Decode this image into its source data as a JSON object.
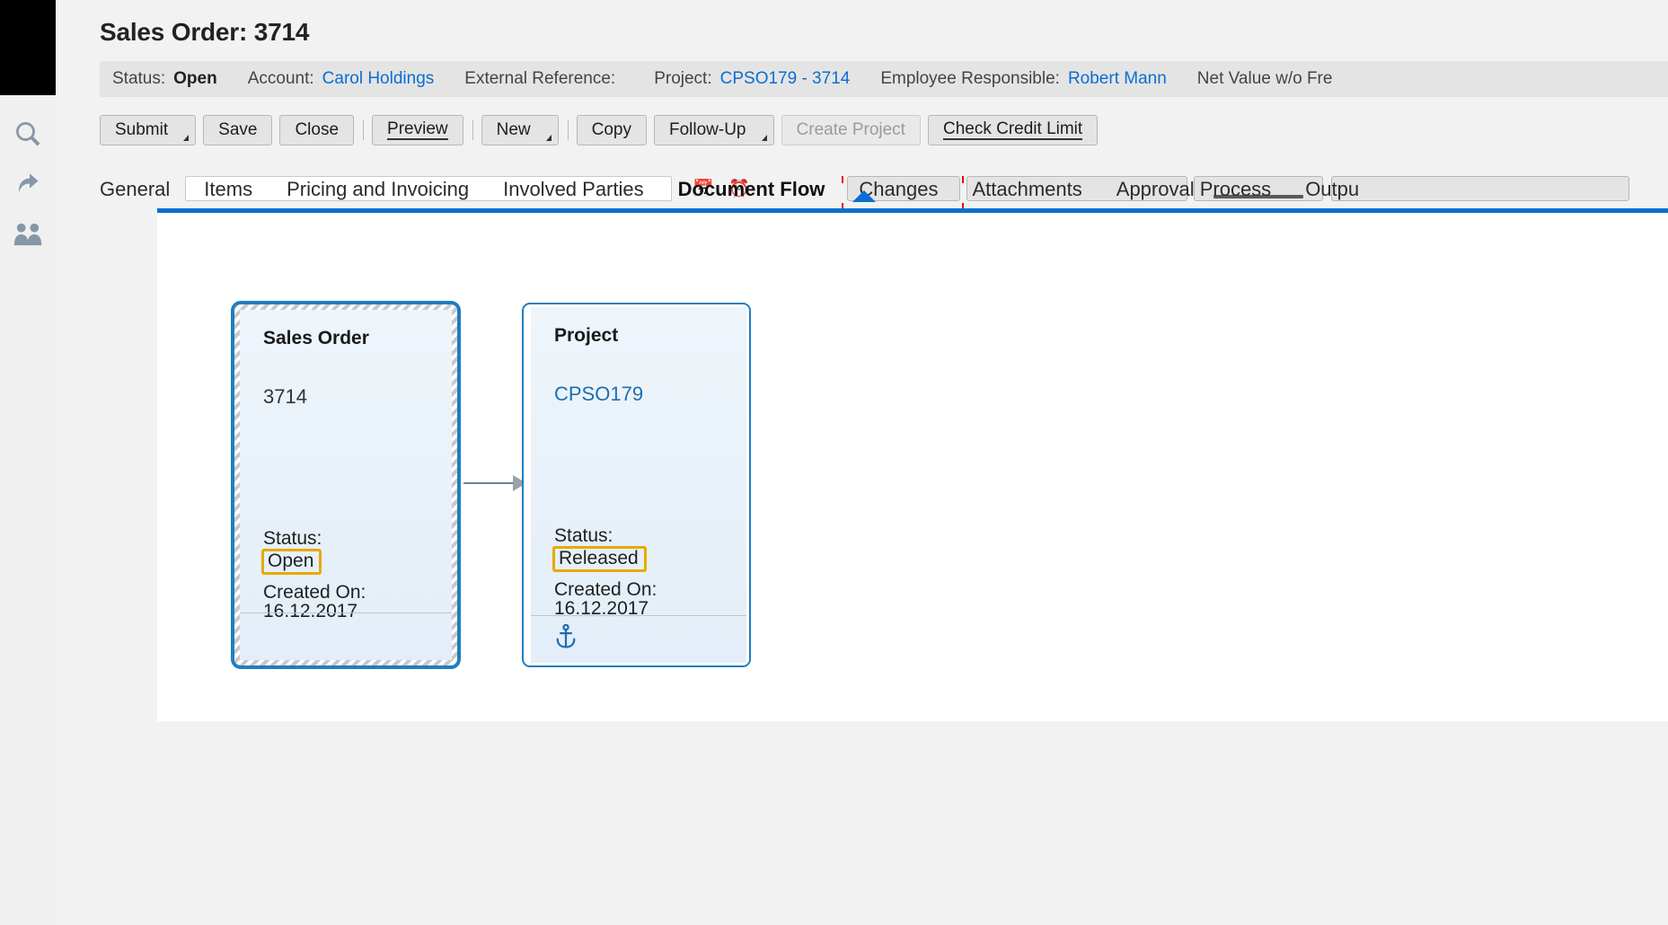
{
  "window": {
    "page_title": "Sales Order: 3714"
  },
  "rail": {
    "items": [
      {
        "name": "search-icon",
        "label": "Search"
      },
      {
        "name": "back-arrow-icon",
        "label": "Back"
      },
      {
        "name": "contacts-icon",
        "label": "Contacts"
      }
    ]
  },
  "statusbar": {
    "items": [
      {
        "label": "Status:",
        "value": "Open",
        "kind": "strong"
      },
      {
        "label": "Account:",
        "value": "Carol Holdings",
        "kind": "link"
      },
      {
        "label": "External Reference:",
        "value": "",
        "kind": "plain"
      },
      {
        "label": "Project:",
        "value": "CPSO179 - 3714",
        "kind": "link"
      },
      {
        "label": "Employee Responsible:",
        "value": "Robert Mann",
        "kind": "link"
      },
      {
        "label": "Net Value w/o Fre",
        "value": "",
        "kind": "plain"
      }
    ]
  },
  "toolbar": {
    "buttons": [
      {
        "label": "Submit",
        "caret": true,
        "disabled": false,
        "underline": false,
        "sep_after": false
      },
      {
        "label": "Save",
        "caret": false,
        "disabled": false,
        "underline": false,
        "sep_after": false
      },
      {
        "label": "Close",
        "caret": false,
        "disabled": false,
        "underline": false,
        "sep_after": true
      },
      {
        "label": "Preview",
        "caret": false,
        "disabled": false,
        "underline": true,
        "sep_after": true
      },
      {
        "label": "New",
        "caret": true,
        "disabled": false,
        "underline": false,
        "sep_after": true
      },
      {
        "label": "Copy",
        "caret": false,
        "disabled": false,
        "underline": false,
        "sep_after": false
      },
      {
        "label": "Follow-Up",
        "caret": true,
        "disabled": false,
        "underline": false,
        "sep_after": false
      },
      {
        "label": "Create Project",
        "caret": false,
        "disabled": true,
        "underline": false,
        "sep_after": false
      },
      {
        "label": "Check Credit Limit",
        "caret": false,
        "disabled": false,
        "underline": true,
        "sep_after": false
      }
    ]
  },
  "tabs": {
    "items": [
      {
        "label": "General",
        "active": false
      },
      {
        "label": "Items",
        "active": false
      },
      {
        "label": "Pricing and Invoicing",
        "active": false
      },
      {
        "label": "Involved Parties",
        "active": false
      },
      {
        "label": "Document Flow",
        "active": true
      },
      {
        "label": "Changes",
        "active": false
      },
      {
        "label": "Attachments",
        "active": false
      },
      {
        "label": "Approval Process",
        "active": false
      },
      {
        "label": "Outpu",
        "active": false
      }
    ]
  },
  "document_flow": {
    "nodes": [
      {
        "id": "sales-order",
        "title": "Sales Order",
        "identifier": "3714",
        "identifier_is_link": false,
        "status_label": "Status:",
        "status_value": "Open",
        "created_label": "Created On:",
        "created_value": "16.12.2017",
        "selected": true,
        "footer_icon": ""
      },
      {
        "id": "project",
        "title": "Project",
        "identifier": "CPSO179",
        "identifier_is_link": true,
        "status_label": "Status:",
        "status_value": "Released",
        "created_label": "Created On:",
        "created_value": "16.12.2017",
        "selected": false,
        "footer_icon": "anchor-icon"
      }
    ],
    "edges": [
      {
        "from": "sales-order",
        "to": "project"
      }
    ]
  },
  "colors": {
    "accent_blue": "#0a6ed1",
    "node_border_blue": "#1f7ec0",
    "highlight_orange": "#e9a800",
    "link_blue": "#1c6fb0",
    "status_bar_bg": "#e4e4e4",
    "red_marker": "#e8000d"
  }
}
